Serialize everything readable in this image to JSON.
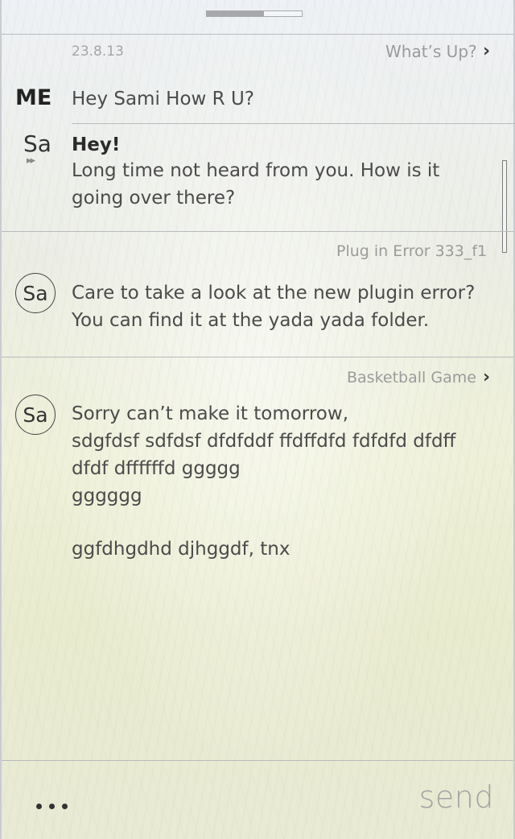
{
  "header": {
    "date": "23.8.13",
    "topic": "What’s Up?"
  },
  "messages": {
    "me": {
      "sender": "ME",
      "text": "Hey Sami How R U?"
    },
    "reply": {
      "sender": "Sa",
      "heading": "Hey!",
      "line1": "Long time not heard from you. How is it",
      "line2": "going over there?"
    }
  },
  "thread2": {
    "topic": "Plug in Error 333_f1",
    "sender": "Sa",
    "line1": "Care to take a look at the new plugin error?",
    "line2": "You can find it at the yada yada folder."
  },
  "thread3": {
    "topic": "Basketball Game",
    "sender": "Sa",
    "line1": "Sorry can’t make it tomorrow,",
    "line2": "sdgfdsf sdfdsf dfdfddf ffdffdfd fdfdfd dfdff",
    "line3": "dfdf dffffffd ggggg",
    "line4": "gggggg",
    "line5": "ggfdhgdhd djhggdf, tnx"
  },
  "composer": {
    "send_label": "send",
    "more_icon": "more-dots-icon"
  },
  "icons": {
    "chevron": "›",
    "play": "▸▸"
  }
}
